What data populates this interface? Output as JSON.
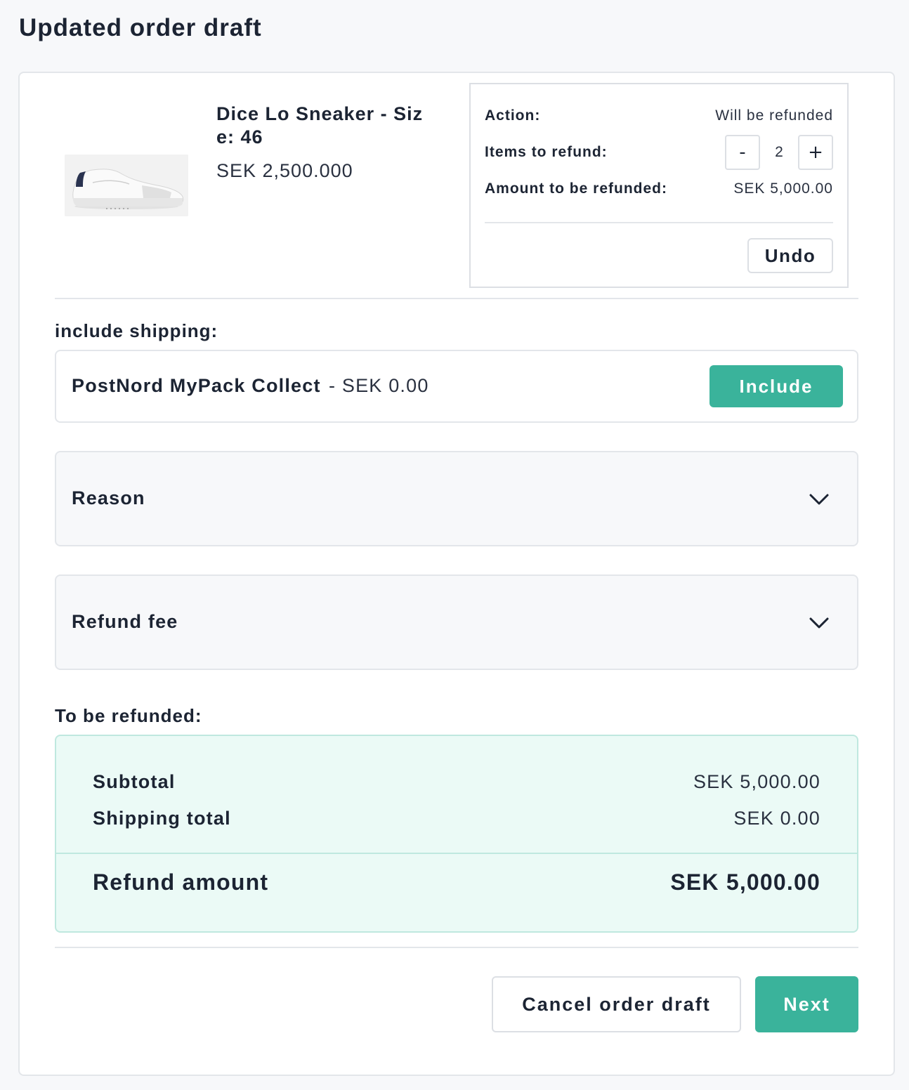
{
  "page": {
    "title": "Updated order draft"
  },
  "product": {
    "name": "Dice Lo Sneaker - Size: 46",
    "price": "SEK 2,500.000",
    "image_icon": "sneaker-product-image"
  },
  "action_panel": {
    "action_label": "Action:",
    "action_value": "Will be refunded",
    "items_label": "Items to refund:",
    "decrement_label": "-",
    "quantity": "2",
    "increment_label": "+",
    "amount_label": "Amount to be refunded:",
    "amount_value": "SEK 5,000.00",
    "undo_label": "Undo"
  },
  "shipping": {
    "section_label": "include shipping:",
    "method_name": "PostNord MyPack Collect",
    "method_price": "- SEK 0.00",
    "include_label": "Include"
  },
  "accordions": {
    "reason_label": "Reason",
    "refund_fee_label": "Refund fee"
  },
  "summary": {
    "section_label": "To be refunded:",
    "subtotal_label": "Subtotal",
    "subtotal_value": "SEK 5,000.00",
    "shipping_total_label": "Shipping total",
    "shipping_total_value": "SEK 0.00",
    "refund_amount_label": "Refund amount",
    "refund_amount_value": "SEK 5,000.00"
  },
  "footer": {
    "cancel_label": "Cancel order draft",
    "next_label": "Next"
  },
  "colors": {
    "accent": "#3ab39b",
    "summary_background": "#ebfaf6",
    "text": "#1c2433"
  }
}
